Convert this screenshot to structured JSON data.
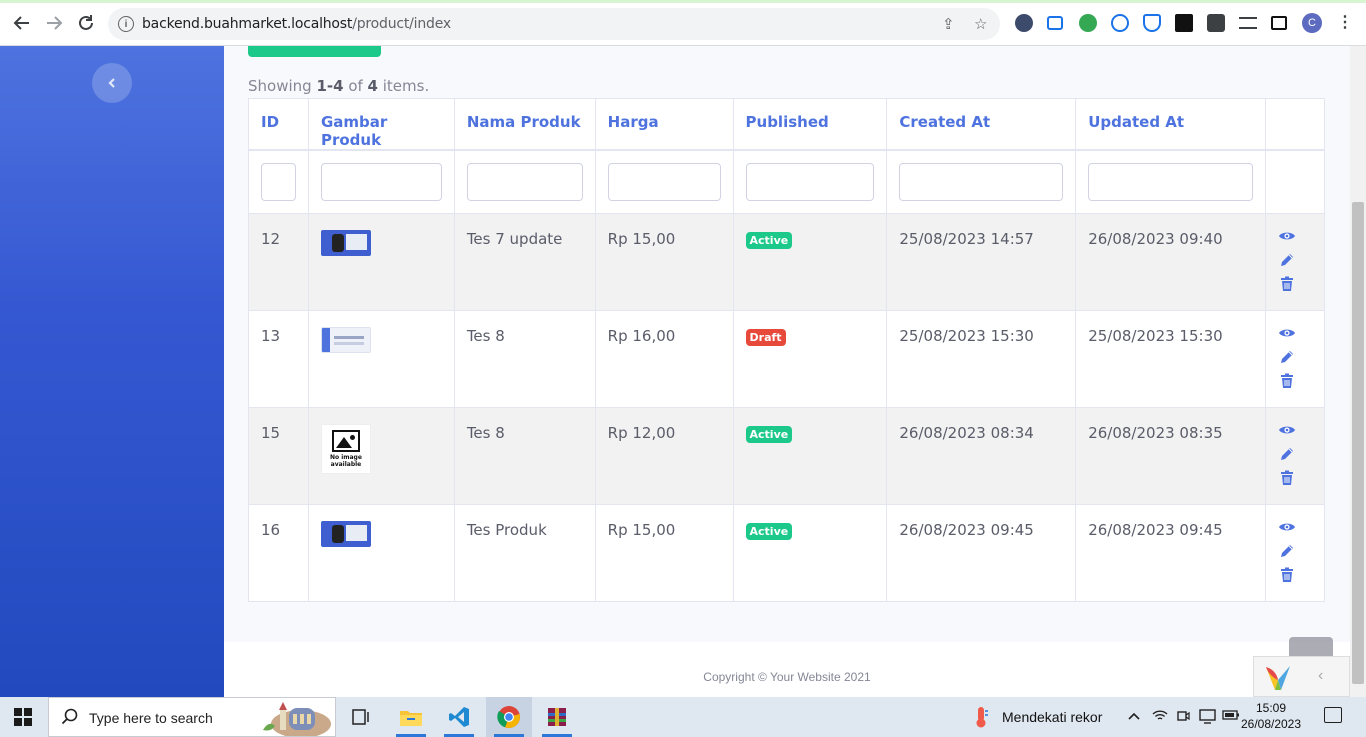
{
  "browser": {
    "url_host": "backend.buahmarket.localhost",
    "url_path": "/product/index",
    "profile_initial": "C"
  },
  "summary": {
    "prefix": "Showing ",
    "range": "1-4",
    "middle": " of ",
    "total": "4",
    "suffix": " items."
  },
  "table": {
    "headers": [
      "ID",
      "Gambar Produk",
      "Nama Produk",
      "Harga",
      "Published",
      "Created At",
      "Updated At"
    ],
    "rows": [
      {
        "id": "12",
        "image": "blue",
        "name": "Tes 7 update",
        "price": "Rp 15,00",
        "status": "Active",
        "created": "25/08/2023 14:57",
        "updated": "26/08/2023 09:40"
      },
      {
        "id": "13",
        "image": "light",
        "name": "Tes 8",
        "price": "Rp 16,00",
        "status": "Draft",
        "created": "25/08/2023 15:30",
        "updated": "25/08/2023 15:30"
      },
      {
        "id": "15",
        "image": "noimage",
        "name": "Tes 8",
        "price": "Rp 12,00",
        "status": "Active",
        "created": "26/08/2023 08:34",
        "updated": "26/08/2023 08:35"
      },
      {
        "id": "16",
        "image": "blue",
        "name": "Tes Produk",
        "price": "Rp 15,00",
        "status": "Active",
        "created": "26/08/2023 09:45",
        "updated": "26/08/2023 09:45"
      }
    ],
    "no_image_text_1": "No image",
    "no_image_text_2": "available"
  },
  "footer": {
    "copyright": "Copyright © Your Website 2021"
  },
  "taskbar": {
    "search_placeholder": "Type here to search",
    "weather_text": "Mendekati rekor",
    "time": "15:09",
    "date": "26/08/2023"
  },
  "colors": {
    "primary": "#4e73df",
    "success": "#1cc88a",
    "danger": "#e74a3b"
  }
}
